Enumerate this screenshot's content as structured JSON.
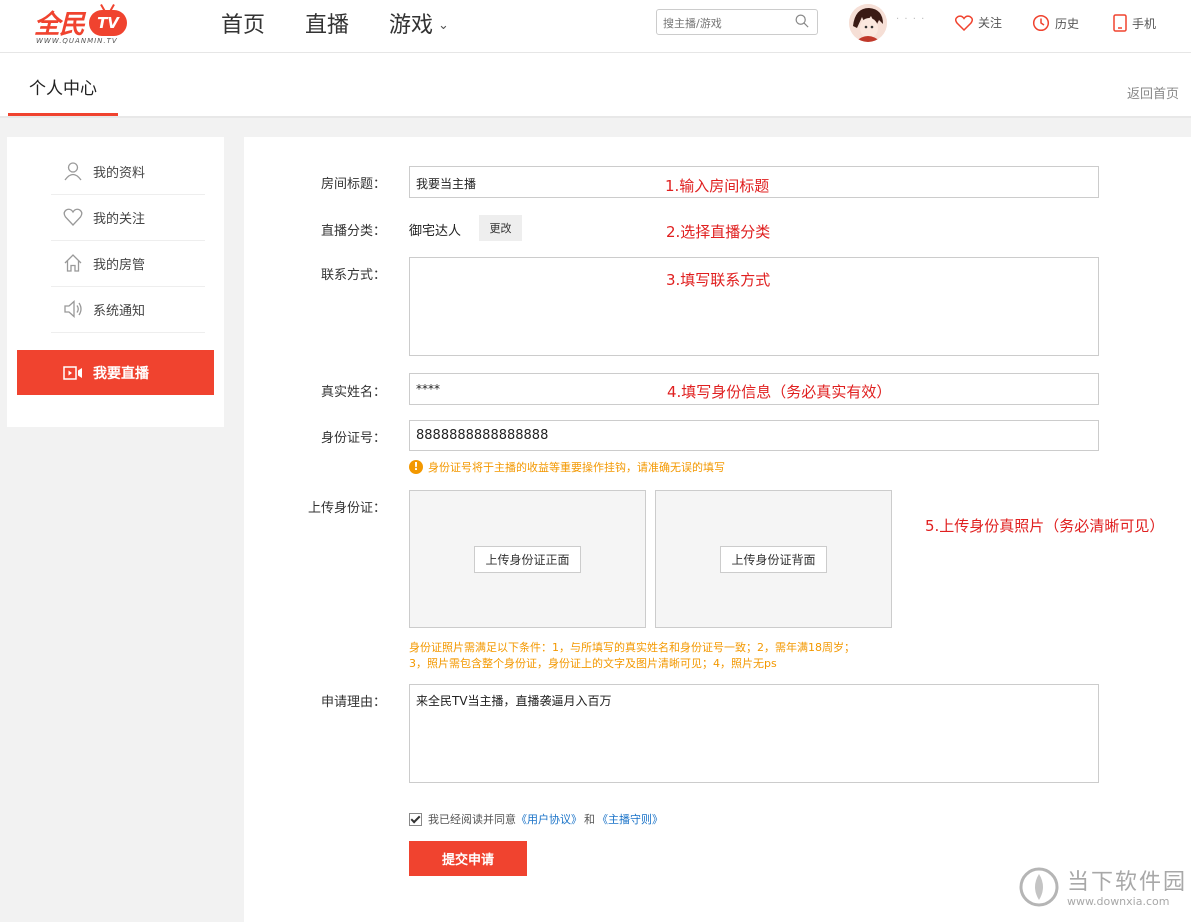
{
  "header": {
    "logo_text": "全民",
    "logo_tv": "TV",
    "logo_sub": "WWW.QUANMIN.TV",
    "nav": [
      "首页",
      "直播",
      "游戏"
    ],
    "search_placeholder": "搜主播/游戏",
    "username": "· · · ·",
    "actions": {
      "follow": "关注",
      "history": "历史",
      "mobile": "手机"
    }
  },
  "subheader": {
    "title": "个人中心",
    "back_home": "返回首页"
  },
  "sidebar": {
    "items": [
      {
        "label": "我的资料",
        "icon": "user-icon"
      },
      {
        "label": "我的关注",
        "icon": "heart-icon"
      },
      {
        "label": "我的房管",
        "icon": "home-icon"
      },
      {
        "label": "系统通知",
        "icon": "speaker-icon"
      }
    ],
    "active": {
      "label": "我要直播",
      "icon": "camera-icon"
    }
  },
  "form": {
    "room_title": {
      "label": "房间标题：",
      "value": "我要当主播"
    },
    "category": {
      "label": "直播分类：",
      "value": "御宅达人",
      "change": "更改"
    },
    "contact": {
      "label": "联系方式：",
      "value": ""
    },
    "real_name": {
      "label": "真实姓名：",
      "value": "****"
    },
    "id_number": {
      "label": "身份证号：",
      "value": "8888888888888888"
    },
    "id_warning": "身份证号将于主播的收益等重要操作挂钩，请准确无误的填写",
    "upload": {
      "label": "上传身份证：",
      "front": "上传身份证正面",
      "back": "上传身份证背面"
    },
    "conditions_line1": "身份证照片需满足以下条件：1，与所填写的真实姓名和身份证号一致；2，需年满18周岁；",
    "conditions_line2": "3，照片需包含整个身份证，身份证上的文字及图片清晰可见；4，照片无ps",
    "reason": {
      "label": "申请理由：",
      "value": "来全民TV当主播，直播袭逼月入百万"
    },
    "agree_text": "我已经阅读并同意",
    "agree_link1": "《用户协议》",
    "agree_and": "和",
    "agree_link2": "《主播守则》",
    "submit": "提交申请"
  },
  "annotations": [
    "1.输入房间标题",
    "2.选择直播分类",
    "3.填写联系方式",
    "4.填写身份信息（务必真实有效）",
    "5.上传身份真照片（务必清晰可见）"
  ],
  "watermark": {
    "text": "当下软件园",
    "url": "www.downxia.com"
  },
  "colors": {
    "accent": "#f0432f",
    "warning": "#f39800",
    "annotation": "#e02020",
    "link": "#1a73c8"
  }
}
